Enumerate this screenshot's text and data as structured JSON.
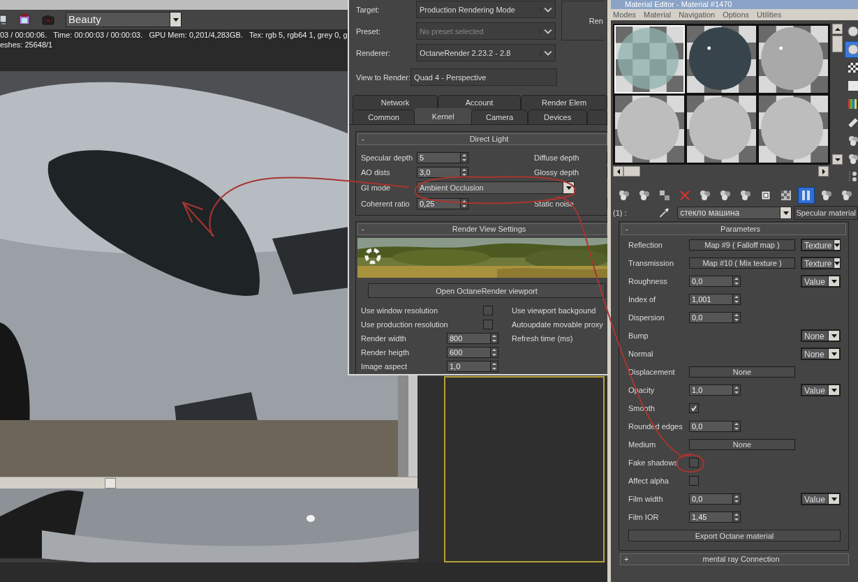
{
  "frame_window": {
    "channel": "Beauty",
    "status_lines": [
      "03 / 00:00:06.   Time: 00:00:03 / 00:00:03.   GPU Mem: 0,201/4,283GB.   Tex: rgb 5, rgb64 1, grey 0, g",
      "eshes: 25648/1"
    ]
  },
  "render_setup": {
    "fields": [
      {
        "label": "Target:",
        "value": "Production Rendering Mode",
        "kind": "dropdown",
        "disabled": false
      },
      {
        "label": "Preset:",
        "value": "No preset selected",
        "kind": "dropdown",
        "disabled": true
      },
      {
        "label": "Renderer:",
        "value": "OctaneRender 2.23.2 - 2.8",
        "kind": "dropdown",
        "disabled": false
      },
      {
        "label": "View to Render:",
        "value": "Quad 4 - Perspective",
        "kind": "text",
        "disabled": false
      }
    ],
    "render_button": "Ren",
    "tab_rows": [
      [
        {
          "label": "Network",
          "selected": false
        },
        {
          "label": "Account",
          "selected": false
        },
        {
          "label": "Render Elem",
          "selected": false
        }
      ],
      [
        {
          "label": "Common",
          "selected": false
        },
        {
          "label": "Kernel",
          "selected": true
        },
        {
          "label": "Camera",
          "selected": false
        },
        {
          "label": "Devices",
          "selected": false
        }
      ]
    ],
    "direct_light": {
      "toggle": "-",
      "title": "Direct Light",
      "rows": [
        {
          "label": "Specular depth",
          "kind": "spinner",
          "value": "5",
          "side_label": "Diffuse depth"
        },
        {
          "label": "AO dists",
          "kind": "spinner",
          "value": "3,0",
          "side_label": "Glossy depth"
        },
        {
          "label": "GI mode",
          "kind": "dropdown",
          "value": "Ambient Occlusion"
        },
        {
          "label": "Coherent ratio",
          "kind": "spinner",
          "value": "0,25",
          "side_label": "Static noise"
        }
      ]
    },
    "render_view": {
      "toggle": "-",
      "title": "Render View Settings",
      "viewport_button": "Open OctaneRender viewport",
      "rows": [
        {
          "label": "Use window resolution",
          "kind": "checkbox",
          "checked": false,
          "side_label": "Use viewport backgound"
        },
        {
          "label": "Use production resolution",
          "kind": "checkbox",
          "checked": false,
          "side_label": "Autoupdate movable proxy"
        },
        {
          "label": "Render width",
          "kind": "spinner",
          "value": "800",
          "side_label": "Refresh time (ms)"
        },
        {
          "label": "Render heigth",
          "kind": "spinner",
          "value": "600"
        },
        {
          "label": "Image aspect",
          "kind": "spinner",
          "value": "1,0"
        }
      ]
    }
  },
  "material_editor": {
    "title": "Material Editor - Material #1470",
    "menu": [
      "Modes",
      "Material",
      "Navigation",
      "Options",
      "Utilities"
    ],
    "slots": [
      {
        "kind": "glass",
        "selected": true
      },
      {
        "kind": "dark",
        "selected": false
      },
      {
        "kind": "light",
        "selected": false
      },
      {
        "kind": "matte",
        "selected": false
      },
      {
        "kind": "matte",
        "selected": false
      },
      {
        "kind": "matte",
        "selected": false
      }
    ],
    "side_tools": [
      {
        "selected": false
      },
      {
        "selected": true
      },
      {
        "selected": false
      },
      {
        "selected": false
      },
      {
        "selected": false
      },
      {
        "selected": false
      },
      {
        "selected": false
      },
      {
        "selected": false
      },
      {
        "selected": false
      }
    ],
    "toolbar": [
      {
        "selected": false
      },
      {
        "selected": false
      },
      {
        "selected": false
      },
      {
        "selected": false
      },
      {
        "selected": false
      },
      {
        "selected": false
      },
      {
        "selected": false
      },
      {
        "selected": false
      },
      {
        "selected": false
      },
      {
        "selected": true
      },
      {
        "selected": false
      },
      {
        "selected": false
      }
    ],
    "slot_label": "(1) :",
    "material_name": "стекло машина",
    "material_type": "Specular material",
    "parameters": {
      "toggle": "-",
      "title": "Parameters",
      "rows": [
        {
          "label": "Reflection",
          "kind": "map",
          "value": "Map #9  ( Falloff map )",
          "mode": "Texture"
        },
        {
          "label": "Transmission",
          "kind": "map",
          "value": "Map #10  ( Mix texture )",
          "mode": "Texture"
        },
        {
          "label": "Roughness",
          "kind": "spinner",
          "value": "0,0",
          "mode": "Value"
        },
        {
          "label": "Index of",
          "kind": "spinner",
          "value": "1,001"
        },
        {
          "label": "Dispersion",
          "kind": "spinner",
          "value": "0,0"
        },
        {
          "label": "Bump",
          "kind": "plain",
          "mode": "None"
        },
        {
          "label": "Normal",
          "kind": "plain",
          "mode": "None"
        },
        {
          "label": "Displacement",
          "kind": "map",
          "value": "None"
        },
        {
          "label": "Opacity",
          "kind": "spinner",
          "value": "1,0",
          "mode": "Value"
        },
        {
          "label": "Smooth",
          "kind": "checkbox",
          "checked": true
        },
        {
          "label": "Rounded edges",
          "kind": "spinner",
          "value": "0,0"
        },
        {
          "label": "Medium",
          "kind": "map",
          "value": "None"
        },
        {
          "label": "Fake shadows",
          "kind": "checkbox",
          "checked": false
        },
        {
          "label": "Affect alpha",
          "kind": "checkbox",
          "checked": false
        },
        {
          "label": "Film width",
          "kind": "spinner",
          "value": "0,0",
          "mode": "Value"
        },
        {
          "label": "Film IOR",
          "kind": "spinner",
          "value": "1,45"
        }
      ],
      "export_button": "Export Octane material"
    },
    "collapsed_rollout": {
      "toggle": "+",
      "title": "mental ray Connection"
    }
  }
}
